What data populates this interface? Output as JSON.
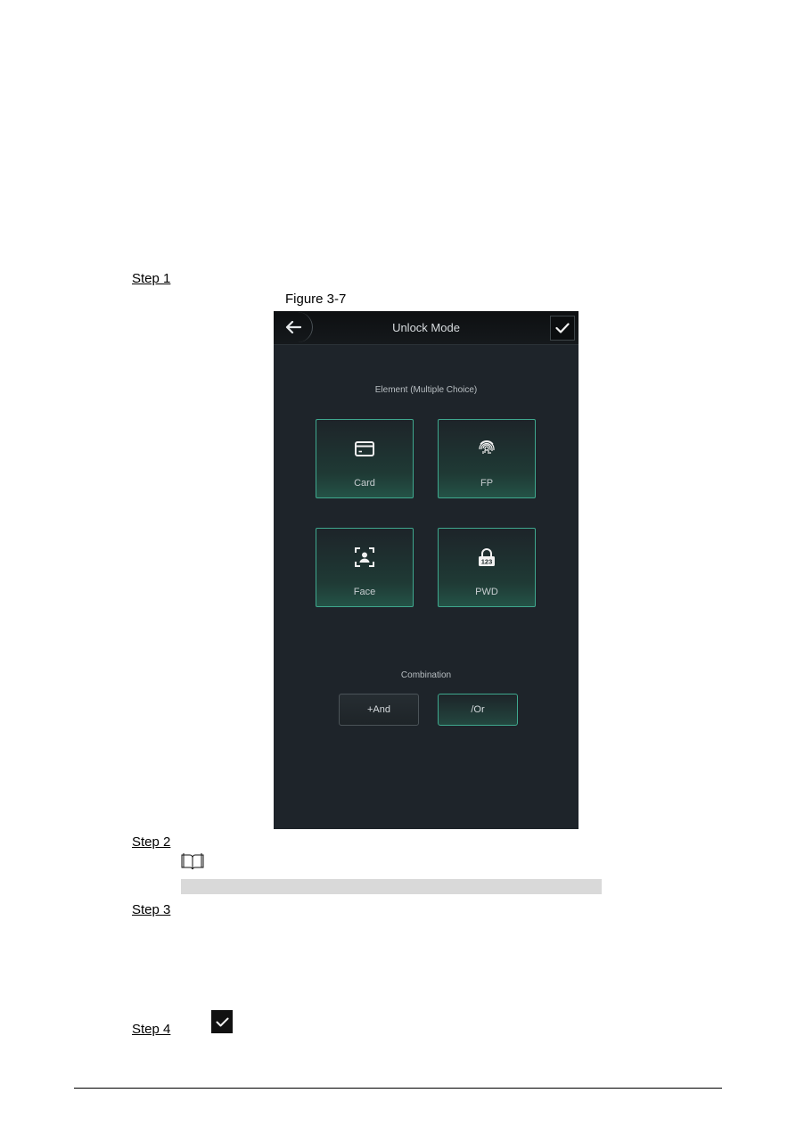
{
  "document": {
    "steps": [
      "Step 1",
      "Step 2",
      "Step 3",
      "Step 4"
    ],
    "figure_caption": "Figure 3-7",
    "note_icon": "book-note-icon"
  },
  "device_screen": {
    "title": "Unlock Mode",
    "back_icon": "arrow-left-icon",
    "confirm_icon": "check-icon",
    "element_section_label": "Element (Multiple Choice)",
    "elements": [
      {
        "label": "Card",
        "icon": "card-icon"
      },
      {
        "label": "FP",
        "icon": "fingerprint-icon"
      },
      {
        "label": "Face",
        "icon": "face-icon"
      },
      {
        "label": "PWD",
        "icon": "password-lock-icon",
        "icon_text": "123"
      }
    ],
    "combination_label": "Combination",
    "combinations": [
      {
        "label": "+And",
        "selected": false
      },
      {
        "label": "/Or",
        "selected": true
      }
    ]
  },
  "colors": {
    "screen_bg": "#1e242a",
    "accent_teal": "#3fa88e",
    "note_bar": "#d9d9d9"
  }
}
